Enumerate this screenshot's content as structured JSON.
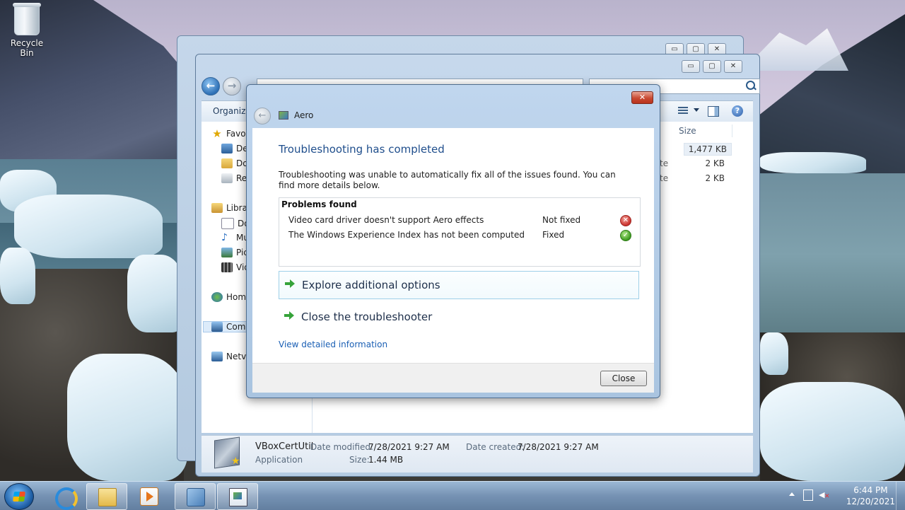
{
  "desktop": {
    "recycle_bin_label": "Recycle Bin"
  },
  "explorer_back": {
    "caption_min": "▭",
    "caption_max": "▢",
    "caption_close": "✕"
  },
  "explorer": {
    "caption_min": "▭",
    "caption_max": "▢",
    "caption_close": "✕",
    "back_glyph": "←",
    "forward_glyph": "→",
    "toolbar_organize": "Organize",
    "help_glyph": "?",
    "nav": [
      {
        "label": "Favo",
        "icon": "star-icon"
      },
      {
        "label": "De",
        "icon": "desktop-icon"
      },
      {
        "label": "Do",
        "icon": "downloads-icon"
      },
      {
        "label": "Re",
        "icon": "recent-places-icon"
      },
      {
        "label": "Libra",
        "icon": "libraries-icon"
      },
      {
        "label": "Do",
        "icon": "documents-icon"
      },
      {
        "label": "Mu",
        "icon": "music-icon"
      },
      {
        "label": "Pic",
        "icon": "pictures-icon"
      },
      {
        "label": "Vid",
        "icon": "videos-icon"
      },
      {
        "label": "Hom",
        "icon": "homegroup-icon"
      },
      {
        "label": "Com",
        "icon": "computer-icon"
      },
      {
        "label": "Netv",
        "icon": "network-icon"
      }
    ],
    "columns": {
      "size": "Size"
    },
    "rows": [
      {
        "type_fragment": "",
        "size": "1,477 KB"
      },
      {
        "type_fragment": "te",
        "size": "2 KB"
      },
      {
        "type_fragment": "te",
        "size": "2 KB"
      }
    ],
    "details": {
      "name": "VBoxCertUtil",
      "type": "Application",
      "date_modified_label": "Date modified:",
      "date_modified": "7/28/2021 9:27 AM",
      "date_created_label": "Date created:",
      "date_created": "7/28/2021 9:27 AM",
      "size_label": "Size:",
      "size": "1.44 MB"
    }
  },
  "dialog": {
    "close_glyph": "✕",
    "back_glyph": "←",
    "app_name": "Aero",
    "heading": "Troubleshooting has completed",
    "description": "Troubleshooting was unable to automatically fix all of the issues found. You can find more details below.",
    "problems_header": "Problems found",
    "problems": [
      {
        "text": "Video card driver doesn't support Aero effects",
        "status": "Not fixed",
        "status_glyph": "✕",
        "status_color": "#c9302c"
      },
      {
        "text": "The Windows Experience Index has not been computed",
        "status": "Fixed",
        "status_glyph": "✓",
        "status_color": "#3c9a1f"
      }
    ],
    "options": [
      {
        "label": "Explore additional options"
      },
      {
        "label": "Close the troubleshooter"
      }
    ],
    "link": "View detailed information",
    "close_button": "Close"
  },
  "taskbar": {
    "apps": [
      {
        "name": "internet-explorer",
        "active": false
      },
      {
        "name": "windows-explorer",
        "active": true
      },
      {
        "name": "media-player",
        "active": false
      },
      {
        "name": "control-panel",
        "active": true
      },
      {
        "name": "troubleshooter",
        "active": true
      }
    ],
    "time": "6:44 PM",
    "date": "12/20/2021"
  },
  "colors": {
    "heading_blue": "#1f4e8c",
    "link_blue": "#1a5fb4",
    "accent_green": "#36a33a"
  }
}
